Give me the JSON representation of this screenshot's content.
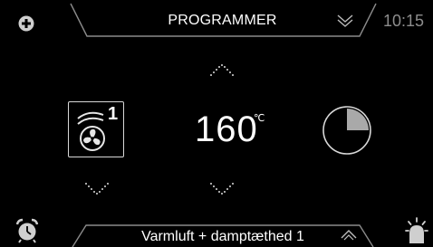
{
  "header": {
    "title": "PROGRAMMER",
    "time": "10:15"
  },
  "footer": {
    "program_name": "Varmluft + damptæthed 1"
  },
  "temperature": {
    "value": "160",
    "unit": "℃"
  },
  "mode": {
    "level": "1"
  },
  "timer": {
    "remaining_fraction": 0.75
  },
  "icons": {
    "top_left": "plus-icon",
    "top_collapse": "double-chevron-down-icon",
    "bottom_left": "alarm-clock-icon",
    "bottom_expand": "chevron-up-icon",
    "bottom_right": "oven-light-icon",
    "mode": "hot-air-fan-icon",
    "timer": "pie-timer-icon"
  },
  "colors": {
    "background": "#000000",
    "tab_border": "#8a8a8a",
    "text": "#ffffff",
    "muted": "#8d8d8d",
    "icon": "#c8c8c8"
  }
}
